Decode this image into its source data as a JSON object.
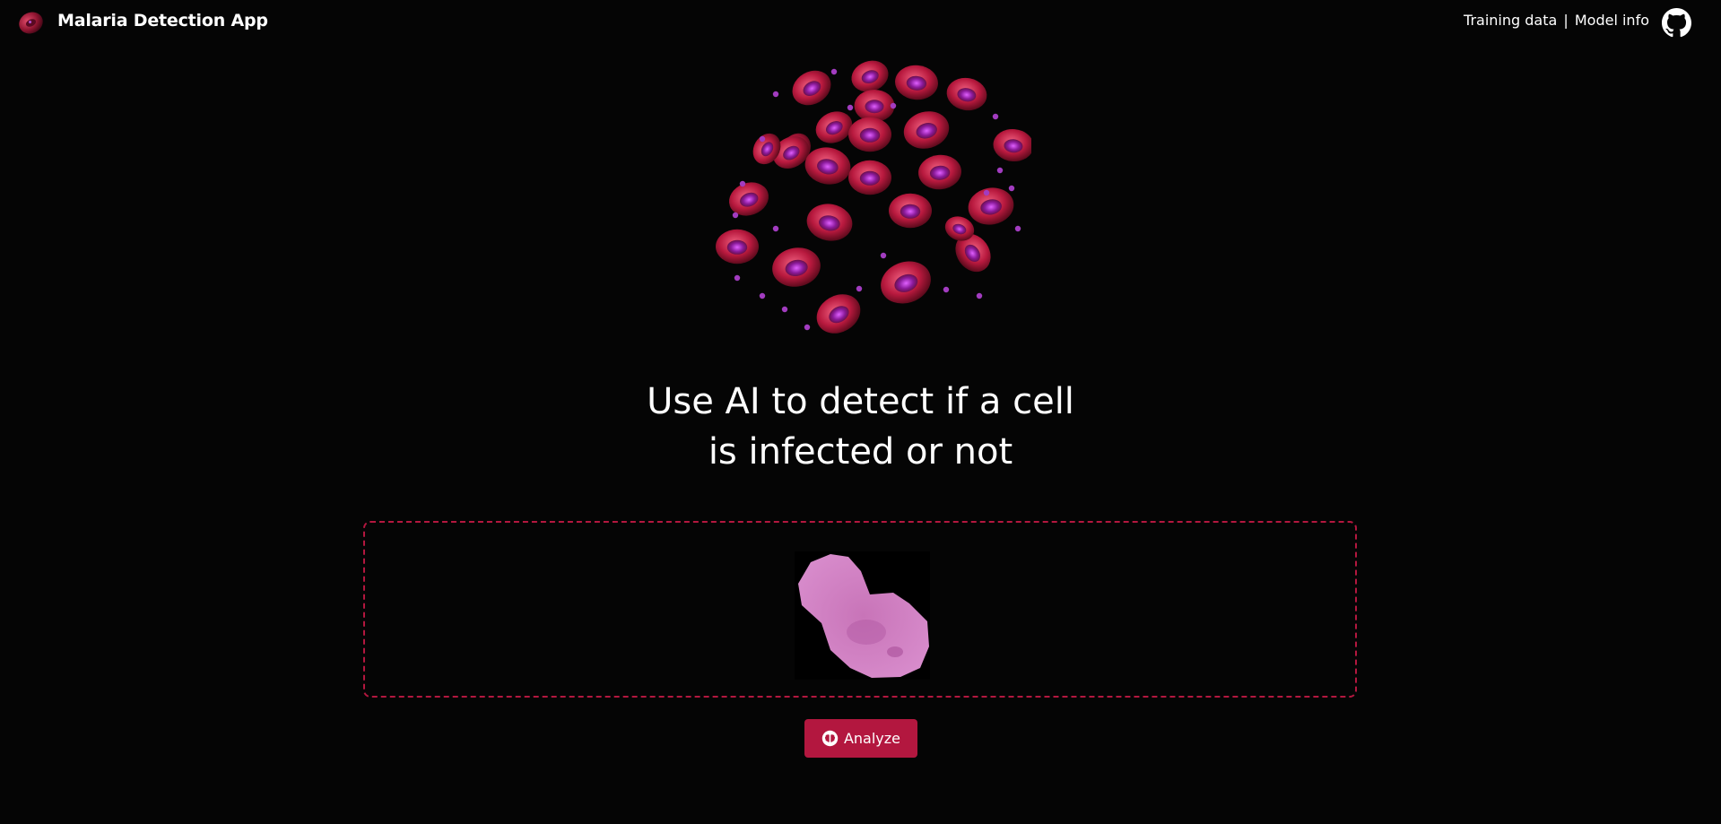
{
  "header": {
    "app_title": "Malaria Detection App",
    "nav": {
      "training_data": "Training data",
      "separator": "|",
      "model_info": "Model info"
    },
    "icons": {
      "logo": "blood-cell-logo-icon",
      "github": "github-icon"
    }
  },
  "hero": {
    "image": "red-blood-cells-illustration",
    "headline_line1": "Use AI to detect if a cell",
    "headline_line2": "is infected or not"
  },
  "upload": {
    "preview": "uploaded-cell-image"
  },
  "actions": {
    "analyze_label": "Analyze",
    "analyze_icon": "brain-icon"
  },
  "colors": {
    "background": "#050505",
    "accent": "#b3173f",
    "text": "#ffffff"
  }
}
